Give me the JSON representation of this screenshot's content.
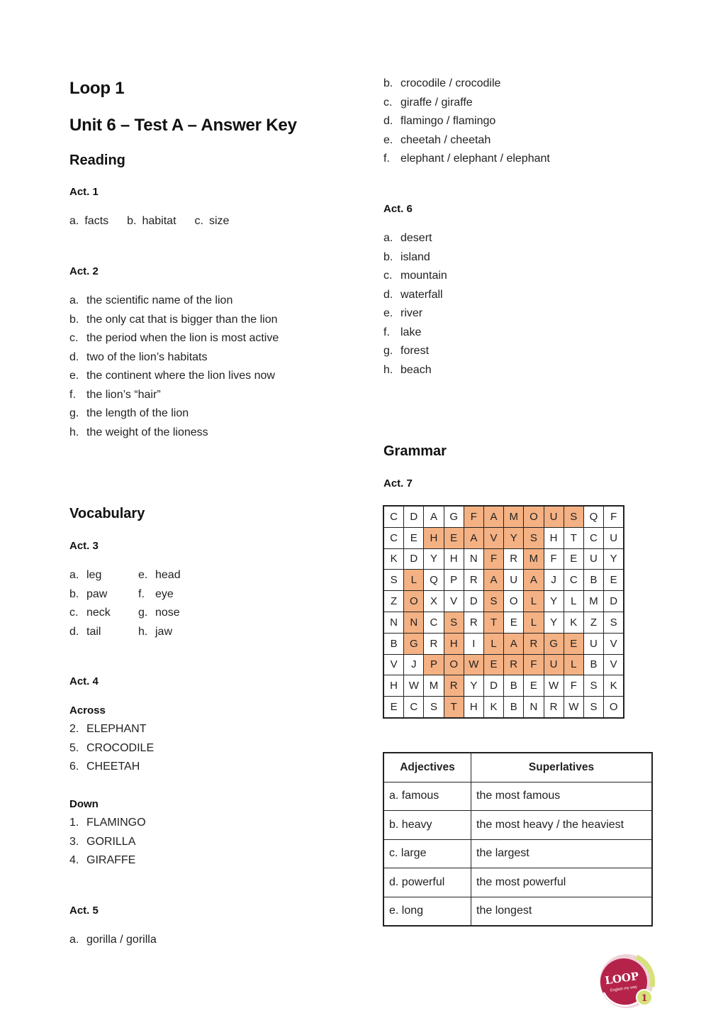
{
  "header": {
    "series": "Loop 1",
    "title": "Unit 6 – Test A – Answer Key"
  },
  "reading": {
    "heading": "Reading",
    "act1": {
      "title": "Act. 1",
      "items": [
        {
          "label": "a.",
          "text": "facts"
        },
        {
          "label": "b.",
          "text": "habitat"
        },
        {
          "label": "c.",
          "text": "size"
        }
      ]
    },
    "act2": {
      "title": "Act. 2",
      "items": [
        {
          "label": "a.",
          "text": "the scientific name of the lion"
        },
        {
          "label": "b.",
          "text": "the only cat that is bigger than the lion"
        },
        {
          "label": "c.",
          "text": "the period when the lion is most active"
        },
        {
          "label": "d.",
          "text": "two of the lion’s habitats"
        },
        {
          "label": "e.",
          "text": "the continent where the lion lives now"
        },
        {
          "label": "f.",
          "text": "the lion’s “hair”"
        },
        {
          "label": "g.",
          "text": "the length of the lion"
        },
        {
          "label": "h.",
          "text": "the weight of the lioness"
        }
      ]
    }
  },
  "vocabulary": {
    "heading": "Vocabulary",
    "act3": {
      "title": "Act. 3",
      "col1": [
        {
          "label": "a.",
          "text": "leg"
        },
        {
          "label": "b.",
          "text": "paw"
        },
        {
          "label": "c.",
          "text": "neck"
        },
        {
          "label": "d.",
          "text": "tail"
        }
      ],
      "col2": [
        {
          "label": "e.",
          "text": "head"
        },
        {
          "label": "f.",
          "text": "eye"
        },
        {
          "label": "g.",
          "text": "nose"
        },
        {
          "label": "h.",
          "text": "jaw"
        }
      ]
    },
    "act4": {
      "title": "Act. 4",
      "across_label": "Across",
      "across": [
        {
          "label": "2.",
          "text": "ELEPHANT"
        },
        {
          "label": "5.",
          "text": "CROCODILE"
        },
        {
          "label": "6.",
          "text": "CHEETAH"
        }
      ],
      "down_label": "Down",
      "down": [
        {
          "label": "1.",
          "text": "FLAMINGO"
        },
        {
          "label": "3.",
          "text": "GORILLA"
        },
        {
          "label": "4.",
          "text": "GIRAFFE"
        }
      ]
    },
    "act5": {
      "title": "Act. 5",
      "items": [
        {
          "label": "a.",
          "text": "gorilla / gorilla"
        },
        {
          "label": "b.",
          "text": "crocodile / crocodile"
        },
        {
          "label": "c.",
          "text": "giraffe / giraffe"
        },
        {
          "label": "d.",
          "text": "flamingo / flamingo"
        },
        {
          "label": "e.",
          "text": "cheetah / cheetah"
        },
        {
          "label": "f.",
          "text": "elephant / elephant / elephant"
        }
      ]
    },
    "act6": {
      "title": "Act. 6",
      "items": [
        {
          "label": "a.",
          "text": "desert"
        },
        {
          "label": "b.",
          "text": "island"
        },
        {
          "label": "c.",
          "text": "mountain"
        },
        {
          "label": "d.",
          "text": "waterfall"
        },
        {
          "label": "e.",
          "text": "river"
        },
        {
          "label": "f.",
          "text": "lake"
        },
        {
          "label": "g.",
          "text": "forest"
        },
        {
          "label": "h.",
          "text": "beach"
        }
      ]
    }
  },
  "grammar": {
    "heading": "Grammar",
    "act7": {
      "title": "Act. 7",
      "highlight_color": "#F4B183",
      "grid": [
        "CDAGFAMOUSQF",
        "CEHEAVYSHTCU",
        "KDYHNFRMFEUY",
        "SLQPRAUAJCBE",
        "ZOXVDSOLYLMD",
        "NNCSRTELYKZS",
        "BGRHILARGEUV",
        "VJPOWERFULBV",
        "HWMRYDBEWFSK",
        "ECSTHKBNRWSO"
      ],
      "highlighted": [
        [
          0,
          4
        ],
        [
          0,
          5
        ],
        [
          0,
          6
        ],
        [
          0,
          7
        ],
        [
          0,
          8
        ],
        [
          0,
          9
        ],
        [
          1,
          2
        ],
        [
          1,
          3
        ],
        [
          1,
          4
        ],
        [
          1,
          5
        ],
        [
          1,
          6
        ],
        [
          1,
          7
        ],
        [
          2,
          5
        ],
        [
          2,
          7
        ],
        [
          3,
          1
        ],
        [
          3,
          5
        ],
        [
          3,
          7
        ],
        [
          4,
          1
        ],
        [
          4,
          5
        ],
        [
          4,
          7
        ],
        [
          5,
          1
        ],
        [
          5,
          3
        ],
        [
          5,
          5
        ],
        [
          5,
          7
        ],
        [
          6,
          1
        ],
        [
          6,
          3
        ],
        [
          6,
          5
        ],
        [
          6,
          6
        ],
        [
          6,
          7
        ],
        [
          6,
          8
        ],
        [
          6,
          9
        ],
        [
          7,
          2
        ],
        [
          7,
          3
        ],
        [
          7,
          4
        ],
        [
          7,
          5
        ],
        [
          7,
          6
        ],
        [
          7,
          7
        ],
        [
          7,
          8
        ],
        [
          7,
          9
        ],
        [
          8,
          3
        ],
        [
          9,
          3
        ]
      ],
      "table": {
        "headers": [
          "Adjectives",
          "Superlatives"
        ],
        "rows": [
          [
            "a. famous",
            "the most famous"
          ],
          [
            "b. heavy",
            "the most heavy / the heaviest"
          ],
          [
            "c. large",
            "the largest"
          ],
          [
            "d. powerful",
            "the most powerful"
          ],
          [
            "e. long",
            "the longest"
          ]
        ]
      }
    }
  },
  "logo": {
    "text": "LOOP",
    "tagline": "English my way",
    "level": "1",
    "colors": {
      "main": "#B5234A",
      "accent": "#D6E27A",
      "ring": "#E9B7C4"
    }
  }
}
